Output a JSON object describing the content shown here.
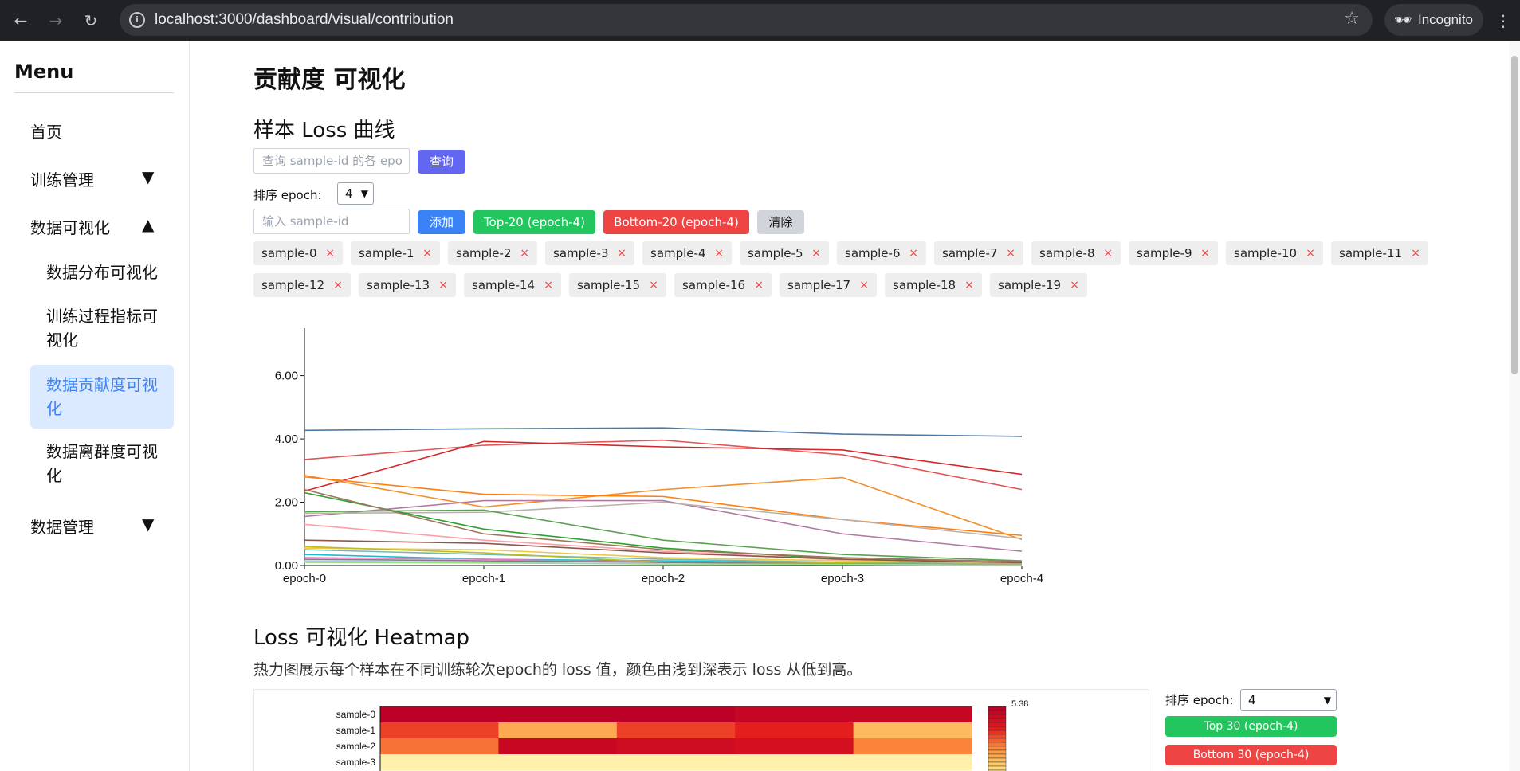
{
  "browser": {
    "url": "localhost:3000/dashboard/visual/contribution",
    "incognito_label": "Incognito"
  },
  "sidebar": {
    "title": "Menu",
    "items": [
      {
        "label": "首页"
      },
      {
        "label": "训练管理",
        "arrow": "▼"
      },
      {
        "label": "数据可视化",
        "arrow": "▲"
      },
      {
        "label": "数据管理",
        "arrow": "▼"
      }
    ],
    "sub_items": [
      {
        "label": "数据分布可视化"
      },
      {
        "label": "训练过程指标可视化"
      },
      {
        "label": "数据贡献度可视化",
        "active": true
      },
      {
        "label": "数据离群度可视化"
      }
    ]
  },
  "page": {
    "title": "贡献度 可视化",
    "loss_section": {
      "title": "样本 Loss 曲线",
      "query_placeholder": "查询 sample-id 的各 epo",
      "query_button": "查询",
      "sort_label": "排序 epoch:",
      "sort_value": "4",
      "add_placeholder": "输入 sample-id",
      "add_button": "添加",
      "top_button": "Top-20 (epoch-4)",
      "bottom_button": "Bottom-20 (epoch-4)",
      "clear_button": "清除",
      "tags": [
        "sample-0",
        "sample-1",
        "sample-2",
        "sample-3",
        "sample-4",
        "sample-5",
        "sample-6",
        "sample-7",
        "sample-8",
        "sample-9",
        "sample-10",
        "sample-11",
        "sample-12",
        "sample-13",
        "sample-14",
        "sample-15",
        "sample-16",
        "sample-17",
        "sample-18",
        "sample-19"
      ],
      "tag_remove": "×"
    },
    "heatmap_section": {
      "title": "Loss 可视化 Heatmap",
      "description": "热力图展示每个样本在不同训练轮次epoch的 loss 值，颜色由浅到深表示 loss 从低到高。",
      "sort_label": "排序 epoch:",
      "sort_value": "4",
      "top_button": "Top 30 (epoch-4)",
      "bottom_button": "Bottom 30 (epoch-4)",
      "scale_max": "5.38",
      "rows": [
        {
          "label": "sample-0",
          "values": [
            5.4,
            5.4,
            5.4,
            5.1,
            5.1
          ]
        },
        {
          "label": "sample-1",
          "values": [
            3.6,
            2.2,
            3.6,
            4.0,
            1.9
          ]
        },
        {
          "label": "sample-2",
          "values": [
            3.0,
            5.0,
            4.8,
            4.6,
            2.8
          ]
        },
        {
          "label": "sample-3",
          "values": [
            0.5,
            0.5,
            0.5,
            0.5,
            0.5
          ]
        }
      ]
    }
  },
  "colors": {
    "accent_purple": "#6366f1",
    "blue": "#3b82f6",
    "green": "#22c55e",
    "red": "#ef4444",
    "gray": "#d1d5db",
    "active_bg": "#dbeafe"
  },
  "chart_data": {
    "type": "line",
    "x": [
      "epoch-0",
      "epoch-1",
      "epoch-2",
      "epoch-3",
      "epoch-4"
    ],
    "ylim": [
      0,
      7.5
    ],
    "yticks": [
      "0.00",
      "2.00",
      "4.00",
      "6.00"
    ],
    "series": [
      {
        "color": "#4e79a7",
        "values": [
          4.27,
          4.32,
          4.35,
          4.15,
          4.08
        ]
      },
      {
        "color": "#e15759",
        "values": [
          3.35,
          3.8,
          3.96,
          3.5,
          2.4
        ]
      },
      {
        "color": "#d62728",
        "values": [
          2.35,
          3.92,
          3.75,
          3.65,
          2.88
        ]
      },
      {
        "color": "#f28e2b",
        "values": [
          2.85,
          1.85,
          2.4,
          2.78,
          0.82
        ]
      },
      {
        "color": "#ff7f0e",
        "values": [
          2.8,
          2.25,
          2.18,
          1.45,
          0.95
        ]
      },
      {
        "color": "#b07aa1",
        "values": [
          1.55,
          2.05,
          2.05,
          1.0,
          0.45
        ]
      },
      {
        "color": "#bab0ac",
        "values": [
          1.65,
          1.68,
          2.0,
          1.45,
          0.85
        ]
      },
      {
        "color": "#59a14f",
        "values": [
          1.7,
          1.75,
          0.8,
          0.35,
          0.15
        ]
      },
      {
        "color": "#2ca02c",
        "values": [
          2.3,
          1.15,
          0.55,
          0.2,
          0.1
        ]
      },
      {
        "color": "#9d755d",
        "values": [
          2.4,
          1.0,
          0.5,
          0.25,
          0.12
        ]
      },
      {
        "color": "#ff9da7",
        "values": [
          1.3,
          0.8,
          0.45,
          0.18,
          0.1
        ]
      },
      {
        "color": "#8c564b",
        "values": [
          0.8,
          0.7,
          0.4,
          0.2,
          0.08
        ]
      },
      {
        "color": "#edc948",
        "values": [
          0.55,
          0.5,
          0.25,
          0.15,
          0.05
        ]
      },
      {
        "color": "#76b7b2",
        "values": [
          0.5,
          0.35,
          0.2,
          0.1,
          0.05
        ]
      },
      {
        "color": "#17becf",
        "values": [
          0.35,
          0.2,
          0.15,
          0.08,
          0.03
        ]
      },
      {
        "color": "#bcbd22",
        "values": [
          0.6,
          0.4,
          0.1,
          0.08,
          0.04
        ]
      },
      {
        "color": "#e377c2",
        "values": [
          0.25,
          0.2,
          0.1,
          0.05,
          0.02
        ]
      },
      {
        "color": "#7f7f7f",
        "values": [
          0.2,
          0.15,
          0.1,
          0.05,
          0.02
        ]
      },
      {
        "color": "#aec7e8",
        "values": [
          0.15,
          0.1,
          0.05,
          0.04,
          0.01
        ]
      },
      {
        "color": "#98df8a",
        "values": [
          0.1,
          0.08,
          0.05,
          0.03,
          0.01
        ]
      }
    ]
  }
}
